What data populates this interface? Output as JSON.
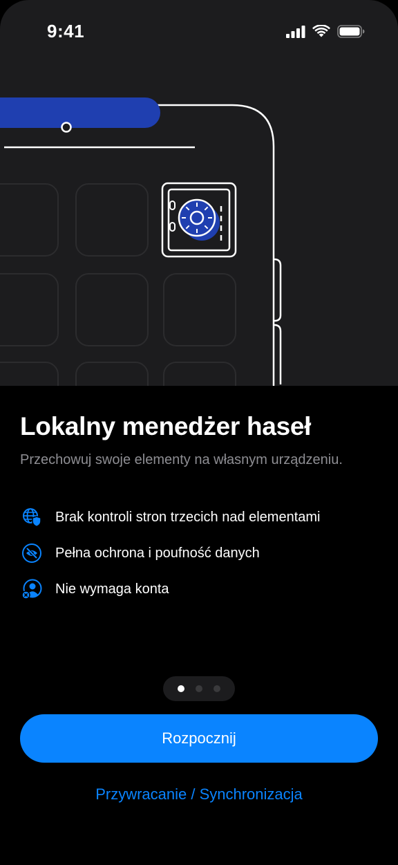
{
  "status_bar": {
    "time": "9:41",
    "icons": [
      "cellular-signal-icon",
      "wifi-icon",
      "battery-icon"
    ]
  },
  "hero": {
    "illustration": "device-vault-illustration",
    "icons": [
      "safe-icon"
    ]
  },
  "onboarding": {
    "title": "Lokalny menedżer haseł",
    "subtitle": "Przechowuj swoje elementy na własnym urządzeniu.",
    "features": [
      {
        "icon": "globe-shield-icon",
        "label": "Brak kontroli stron trzecich nad elementami"
      },
      {
        "icon": "eye-slash-icon",
        "label": "Pełna ochrona i poufność danych"
      },
      {
        "icon": "user-remove-icon",
        "label": "Nie wymaga konta"
      }
    ],
    "pager": {
      "count": 3,
      "active_index": 0
    },
    "primary_button_label": "Rozpocznij",
    "secondary_link_label": "Przywracanie / Synchronizacja"
  },
  "colors": {
    "accent": "#0a84ff",
    "background": "#000000",
    "hero_background": "#1c1c1e",
    "hero_accent": "#1f3fb0",
    "secondary_text": "#8e8e93"
  }
}
